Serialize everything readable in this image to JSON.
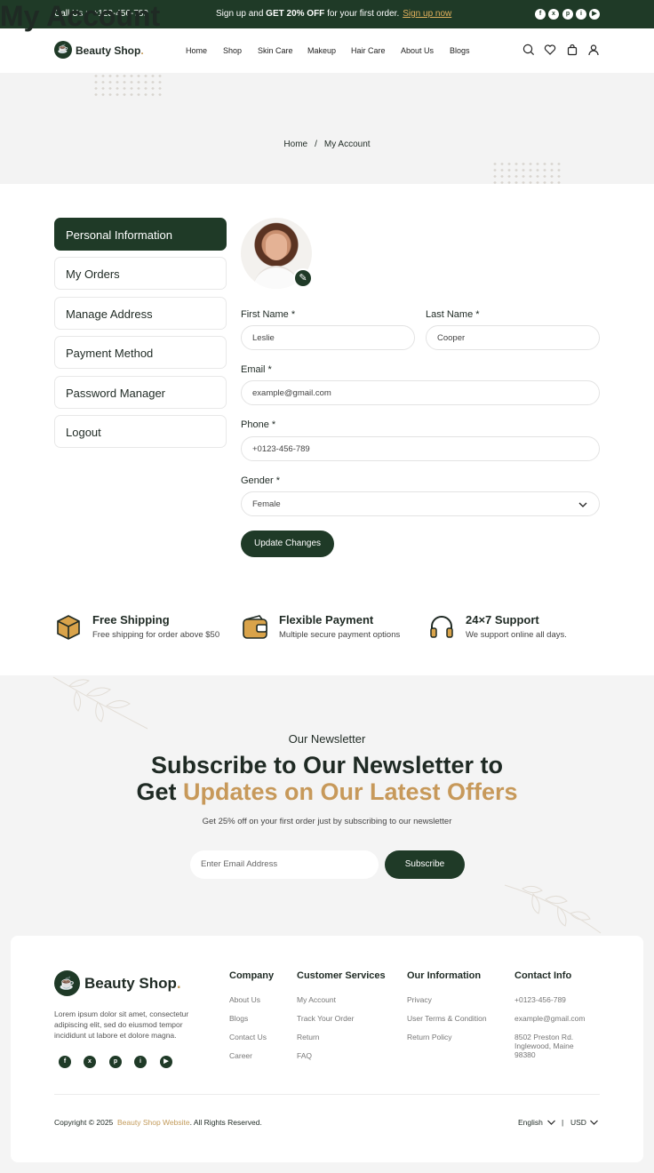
{
  "topbar": {
    "call_label": "Call Us :",
    "call_number": "+123-456-789",
    "promo_prefix": "Sign up and",
    "promo_bold": "GET 20% OFF",
    "promo_suffix": "for your first order.",
    "promo_link": "Sign up now",
    "social": [
      "f",
      "x",
      "p",
      "i",
      "▶"
    ]
  },
  "header": {
    "logo": "Beauty Shop",
    "logo_dot": ".",
    "nav": [
      "Home",
      "Shop",
      "Skin Care",
      "Makeup",
      "Hair Care",
      "About Us",
      "Blogs"
    ],
    "icons": [
      "search-icon",
      "heart-icon",
      "bag-icon",
      "user-icon"
    ]
  },
  "banner": {
    "title": "My Account",
    "crumb_home": "Home",
    "crumb_sep": "/",
    "crumb_current": "My Account"
  },
  "sidebar": {
    "items": [
      "Personal Information",
      "My Orders",
      "Manage Address",
      "Payment Method",
      "Password Manager",
      "Logout"
    ],
    "active_index": 0
  },
  "form": {
    "first_name_label": "First Name *",
    "first_name": "Leslie",
    "last_name_label": "Last Name *",
    "last_name": "Cooper",
    "email_label": "Email *",
    "email": "example@gmail.com",
    "phone_label": "Phone *",
    "phone": "+0123-456-789",
    "gender_label": "Gender *",
    "gender": "Female",
    "submit": "Update Changes"
  },
  "features": [
    {
      "title": "Free Shipping",
      "subtitle": "Free shipping for order above $50",
      "icon": "box-icon"
    },
    {
      "title": "Flexible Payment",
      "subtitle": "Multiple secure payment options",
      "icon": "wallet-icon"
    },
    {
      "title": "24×7 Support",
      "subtitle": "We support online all days.",
      "icon": "headset-icon"
    }
  ],
  "newsletter": {
    "eyebrow": "Our Newsletter",
    "title_line1": "Subscribe to Our Newsletter to",
    "title_line2_plain": "Get",
    "title_line2_gold": "Updates on Our Latest Offers",
    "subtitle": "Get 25% off on your first order just by subscribing to our newsletter",
    "placeholder": "Enter Email Address",
    "button": "Subscribe"
  },
  "footer": {
    "logo": "Beauty Shop",
    "logo_dot": ".",
    "about": "Lorem ipsum dolor sit amet, consectetur adipiscing elit, sed do eiusmod tempor incididunt ut labore et dolore magna.",
    "social": [
      "f",
      "x",
      "p",
      "i",
      "▶"
    ],
    "columns": [
      {
        "title": "Company",
        "links": [
          "About Us",
          "Blogs",
          "Contact Us",
          "Career"
        ]
      },
      {
        "title": "Customer Services",
        "links": [
          "My Account",
          "Track Your Order",
          "Return",
          "FAQ"
        ]
      },
      {
        "title": "Our Information",
        "links": [
          "Privacy",
          "User Terms & Condition",
          "Return Policy"
        ]
      },
      {
        "title": "Contact Info",
        "links": [
          "+0123-456-789",
          "example@gmail.com",
          "8502 Preston Rd. Inglewood, Maine 98380"
        ]
      }
    ],
    "copyright_prefix": "Copyright © 2025",
    "copyright_brand": "Beauty Shop Website",
    "copyright_suffix": ". All Rights Reserved.",
    "language": "English",
    "currency_sep": "|",
    "currency": "USD"
  },
  "colors": {
    "brand": "#1f3a27",
    "accent": "#c7995a"
  }
}
